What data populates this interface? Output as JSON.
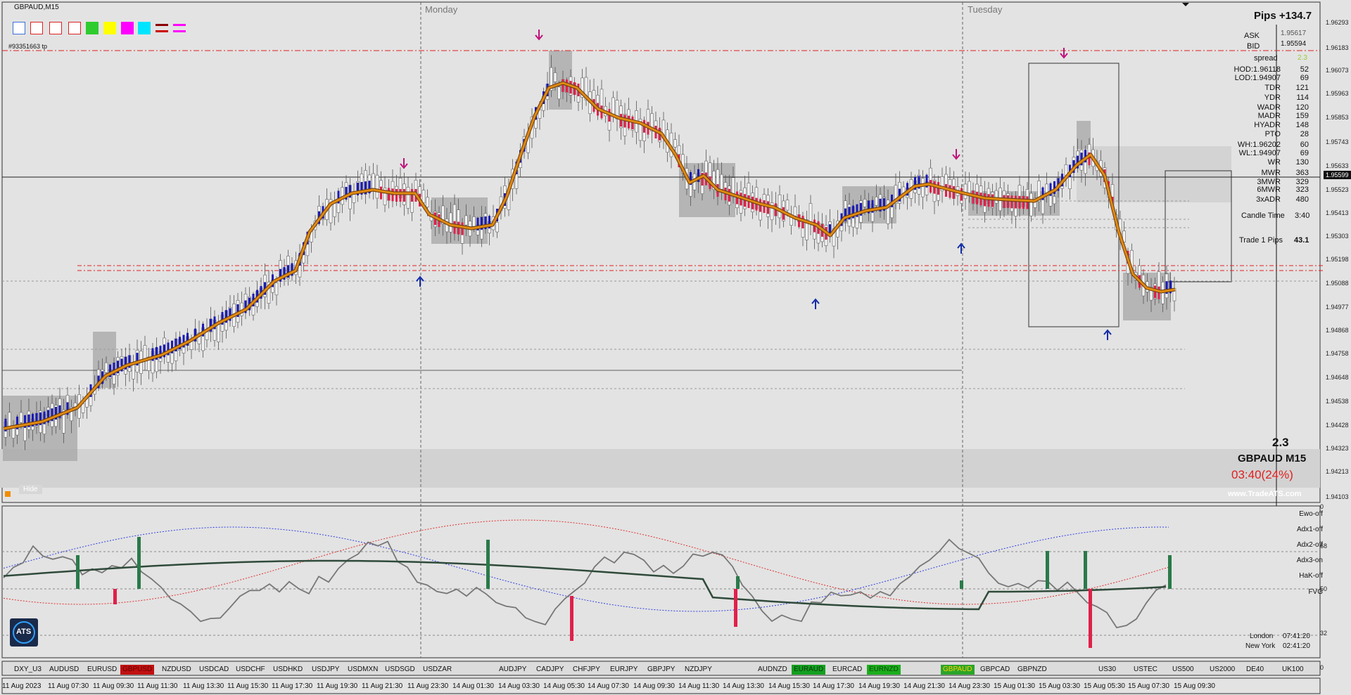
{
  "chart": {
    "title": "GBPAUD,M15",
    "order_label": "#93351663 tp",
    "day_labels": [
      "Monday",
      "Tuesday"
    ],
    "hide_label": "Hide",
    "watermark": "www.TradeATS.com"
  },
  "info_panel": {
    "pips": "Pips +134.7",
    "ask_label": "ASK",
    "ask_value": "1.95617",
    "bid_label": "BID",
    "bid_value": "1.95594",
    "spread_label": "spread",
    "spread_value": "2.3",
    "rows": [
      {
        "label": "HOD:1.96118",
        "value": "52"
      },
      {
        "label": "LOD:1.94907",
        "value": "69"
      },
      {
        "label": "TDR",
        "value": "121"
      },
      {
        "label": "YDR",
        "value": "114"
      },
      {
        "label": "WADR",
        "value": "120"
      },
      {
        "label": "MADR",
        "value": "159"
      },
      {
        "label": "HYADR",
        "value": "148"
      },
      {
        "label": "PTO",
        "value": "28"
      },
      {
        "label": "WH:1.96202",
        "value": "60"
      },
      {
        "label": "WL:1.94907",
        "value": "69"
      },
      {
        "label": "WR",
        "value": "130"
      },
      {
        "label": "MWR",
        "value": "363"
      },
      {
        "label": "3MWR",
        "value": "329"
      },
      {
        "label": "6MWR",
        "value": "323"
      },
      {
        "label": "3xADR",
        "value": "480"
      }
    ],
    "candle_time_label": "Candle Time",
    "candle_time_value": "3:40",
    "trade_label": "Trade 1 Pips",
    "trade_value": "43.1",
    "big_spread": "2.3",
    "symbol_tf": "GBPAUD   M15",
    "countdown": "03:40(24%)"
  },
  "price_axis": [
    "1.96293",
    "1.96183",
    "1.96073",
    "1.95963",
    "1.95853",
    "1.95743",
    "1.95633",
    "1.95599",
    "1.95523",
    "1.95413",
    "1.95303",
    "1.95198",
    "1.95088",
    "1.94977",
    "1.94868",
    "1.94758",
    "1.94648",
    "1.94538",
    "1.94428",
    "1.94323",
    "1.94213",
    "1.94103"
  ],
  "indicator": {
    "axis": [
      "0",
      "68",
      "50",
      "32",
      "0"
    ],
    "labels": [
      "Ewo-off",
      "Adx1-off",
      "Adx2-off",
      "Adx3-on",
      "HaK-off",
      "FVG"
    ],
    "sessions": [
      {
        "label": "London",
        "time": "07:41:20"
      },
      {
        "label": "New York",
        "time": "02:41:20"
      }
    ]
  },
  "symbols": [
    {
      "label": "DXY_U3",
      "style": ""
    },
    {
      "label": "AUDUSD",
      "style": ""
    },
    {
      "label": "EURUSD",
      "style": ""
    },
    {
      "label": "GBPUSD",
      "style": "on-red"
    },
    {
      "label": "NZDUSD",
      "style": ""
    },
    {
      "label": "USDCAD",
      "style": ""
    },
    {
      "label": "USDCHF",
      "style": ""
    },
    {
      "label": "USDHKD",
      "style": ""
    },
    {
      "label": "USDJPY",
      "style": ""
    },
    {
      "label": "USDMXN",
      "style": ""
    },
    {
      "label": "USDSGD",
      "style": ""
    },
    {
      "label": "USDZAR",
      "style": ""
    },
    {
      "label": "AUDJPY",
      "style": ""
    },
    {
      "label": "CADJPY",
      "style": ""
    },
    {
      "label": "CHFJPY",
      "style": ""
    },
    {
      "label": "EURJPY",
      "style": ""
    },
    {
      "label": "GBPJPY",
      "style": ""
    },
    {
      "label": "NZDJPY",
      "style": ""
    },
    {
      "label": "AUDNZD",
      "style": ""
    },
    {
      "label": "EURAUD",
      "style": "on-green"
    },
    {
      "label": "EURCAD",
      "style": ""
    },
    {
      "label": "EURNZD",
      "style": "on-green2"
    },
    {
      "label": "GBPAUD",
      "style": "on-gold"
    },
    {
      "label": "GBPCAD",
      "style": ""
    },
    {
      "label": "GBPNZD",
      "style": ""
    },
    {
      "label": "US30",
      "style": ""
    },
    {
      "label": "USTEC",
      "style": ""
    },
    {
      "label": "US500",
      "style": ""
    },
    {
      "label": "US2000",
      "style": ""
    },
    {
      "label": "DE40",
      "style": ""
    },
    {
      "label": "UK100",
      "style": ""
    }
  ],
  "time_axis": [
    "11 Aug 2023",
    "11 Aug 07:30",
    "11 Aug 09:30",
    "11 Aug 11:30",
    "11 Aug 13:30",
    "11 Aug 15:30",
    "11 Aug 17:30",
    "11 Aug 19:30",
    "11 Aug 21:30",
    "11 Aug 23:30",
    "14 Aug 01:30",
    "14 Aug 03:30",
    "14 Aug 05:30",
    "14 Aug 07:30",
    "14 Aug 09:30",
    "14 Aug 11:30",
    "14 Aug 13:30",
    "14 Aug 15:30",
    "14 Aug 17:30",
    "14 Aug 19:30",
    "14 Aug 21:30",
    "14 Aug 23:30",
    "15 Aug 01:30",
    "15 Aug 03:30",
    "15 Aug 05:30",
    "15 Aug 07:30",
    "15 Aug 09:30"
  ],
  "colors": {
    "bull": "#1a1ab4",
    "bear": "#e0204a",
    "ma": "#e08a10",
    "level": "#e02020",
    "bg": "#e3e3e3",
    "gray_box": "#a8a8a8"
  },
  "toolbar": {
    "swatches": [
      "#3b6fd8",
      "#d22",
      "#d22",
      "#d22",
      "#2ecc2e",
      "#ffff00",
      "#ff00ff",
      "#00e5ff",
      "#8b0000",
      "#ff00ff"
    ]
  },
  "logo_text": "ATS"
}
